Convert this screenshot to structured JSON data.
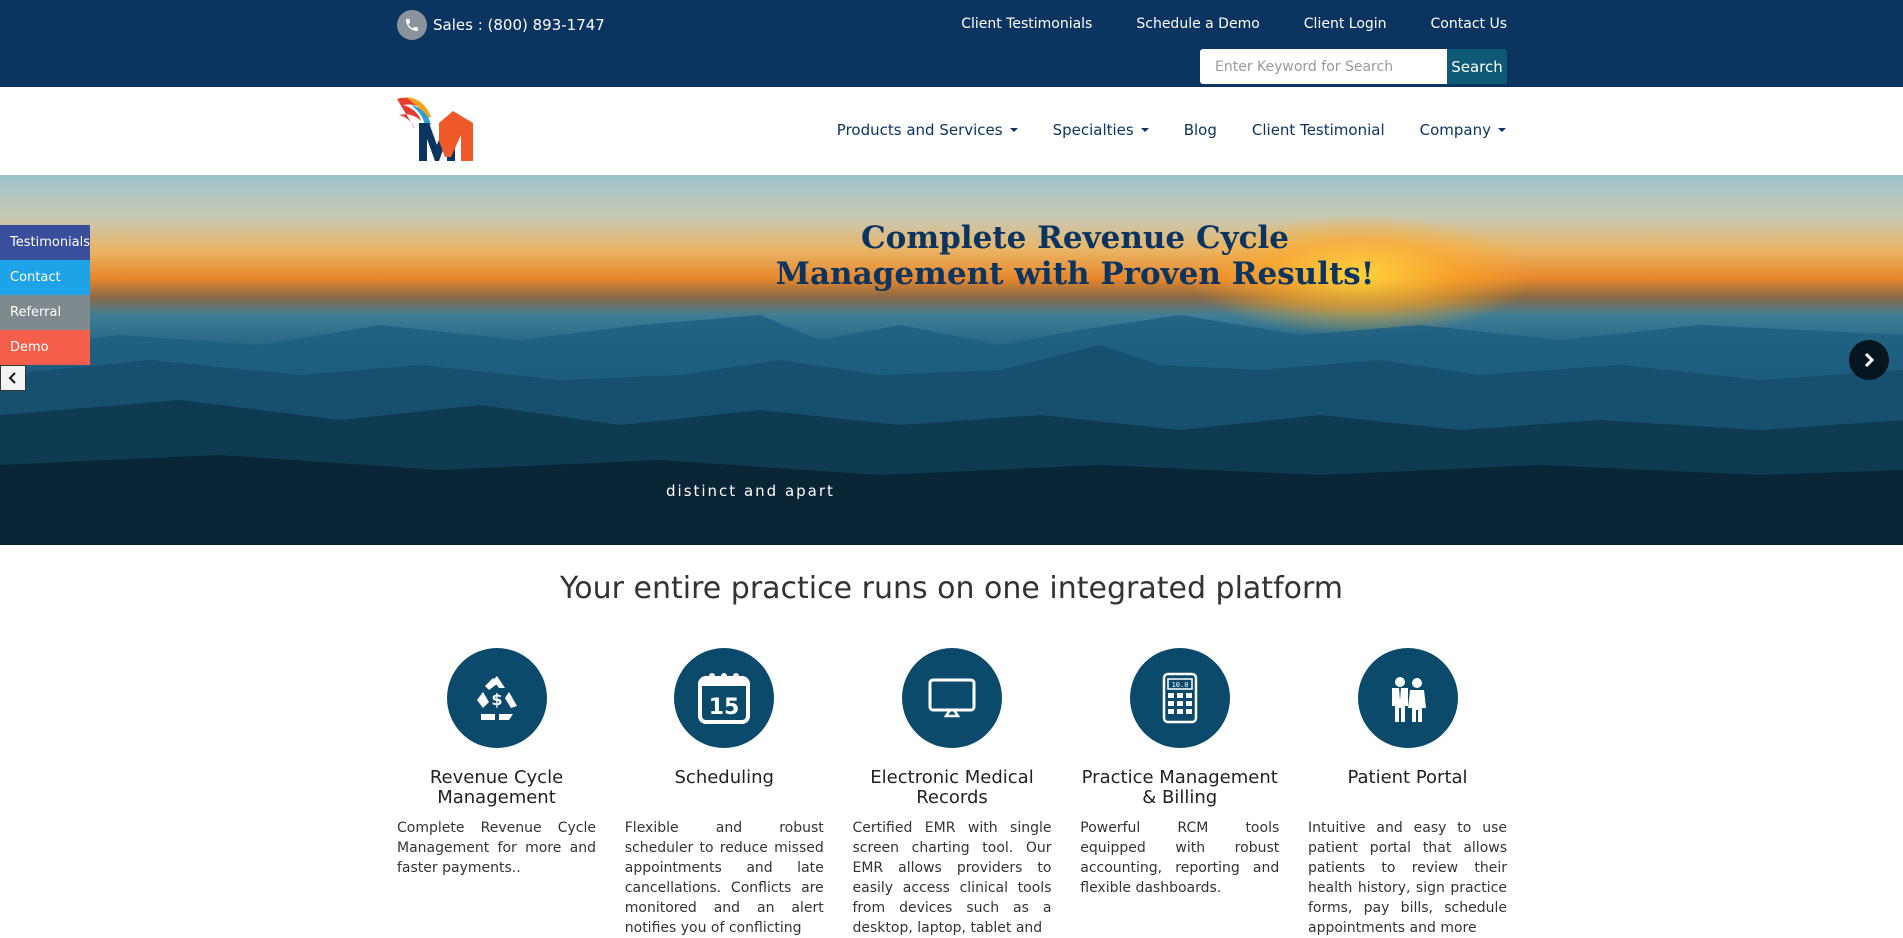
{
  "topbar": {
    "phone": "Sales : (800) 893-1747",
    "links": [
      "Client Testimonials",
      "Schedule a Demo",
      "Client Login",
      "Contact Us"
    ],
    "search_placeholder": "Enter Keyword for Search",
    "search_button": "Search"
  },
  "nav": {
    "items": [
      {
        "label": "Products and Services",
        "dropdown": true
      },
      {
        "label": "Specialties",
        "dropdown": true
      },
      {
        "label": "Blog",
        "dropdown": false
      },
      {
        "label": "Client Testimonial",
        "dropdown": false
      },
      {
        "label": "Company",
        "dropdown": true
      }
    ]
  },
  "sidetabs": [
    {
      "label": "Testimonials",
      "color": "#3a4f9b"
    },
    {
      "label": "Contact",
      "color": "#1fa3e8"
    },
    {
      "label": "Referral",
      "color": "#7e8b8e"
    },
    {
      "label": "Demo",
      "color": "#f45e4a"
    }
  ],
  "hero": {
    "title_line1": "Complete Revenue Cycle",
    "title_line2": "Management with Proven Results!",
    "tagline": "distinct and apart"
  },
  "features": {
    "heading": "Your entire practice runs on one integrated platform",
    "items": [
      {
        "icon": "recycle-dollar-icon",
        "title": "Revenue Cycle Management",
        "text": "Complete Revenue Cycle Management for more and faster payments.."
      },
      {
        "icon": "calendar-icon",
        "title": "Scheduling",
        "text": "Flexible and robust scheduler to reduce missed appointments and late cancellations. Conflicts are monitored and an alert notifies you of conflicting"
      },
      {
        "icon": "monitor-icon",
        "title": "Electronic Medical Records",
        "text": "Certified EMR with single screen charting tool. Our EMR allows providers to easily access clinical tools from devices such as a desktop, laptop, tablet and"
      },
      {
        "icon": "calculator-icon",
        "title": "Practice Management & Billing",
        "text": "Powerful RCM tools equipped with robust accounting, reporting and flexible dashboards."
      },
      {
        "icon": "doctor-patient-icon",
        "title": "Patient Portal",
        "text": "Intuitive and easy to use patient portal that allows patients to review their health history, sign practice forms, pay bills, schedule appointments and more"
      }
    ]
  },
  "colors": {
    "navy": "#0b3560",
    "icon_bg": "#0b4a6b",
    "search_button": "#0e5a75"
  }
}
